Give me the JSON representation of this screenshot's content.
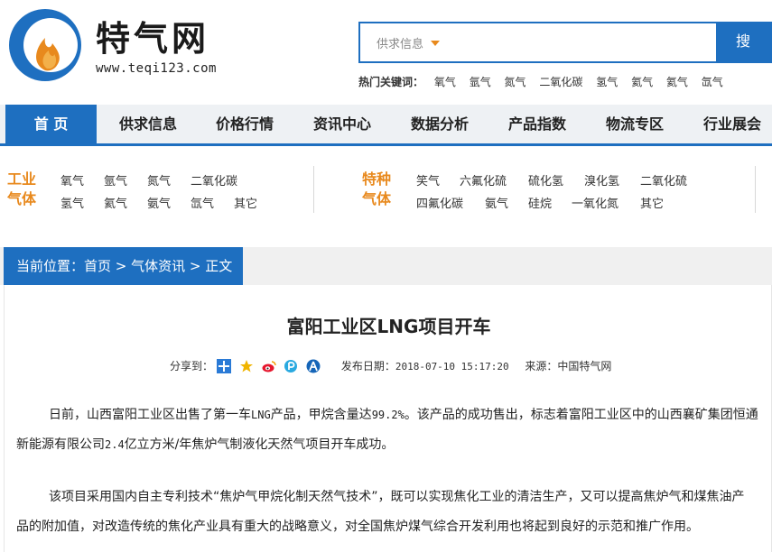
{
  "header": {
    "brand": "特气网",
    "url": "www.teqi123.com",
    "search_category": "供求信息",
    "search_button": "搜 索",
    "hot_label": "热门关键词：",
    "hot_keywords": [
      "氧气",
      "氩气",
      "氮气",
      "二氧化碳",
      "氢气",
      "氦气",
      "氦气",
      "氙气"
    ]
  },
  "nav": {
    "items": [
      "首 页",
      "供求信息",
      "价格行情",
      "资讯中心",
      "数据分析",
      "产品指数",
      "物流专区",
      "行业展会"
    ]
  },
  "categories": {
    "industrial": {
      "label_1": "工业",
      "label_2": "气体",
      "row1": [
        "氧气",
        "氩气",
        "氮气",
        "二氧化碳"
      ],
      "row2": [
        "氢气",
        "氦气",
        "氨气",
        "氙气",
        "其它"
      ]
    },
    "special": {
      "label_1": "特种",
      "label_2": "气体",
      "row1": [
        "笑气",
        "六氟化硫",
        "硫化氢",
        "溴化氢",
        "二氧化硫"
      ],
      "row2": [
        "四氟化碳",
        "氨气",
        "硅烷",
        "一氧化氮",
        "其它"
      ]
    }
  },
  "breadcrumb": {
    "prefix": "当前位置：",
    "items": [
      "首页",
      "气体资讯",
      "正文"
    ],
    "sep": " > "
  },
  "article": {
    "title": "富阳工业区LNG项目开车",
    "share_label": "分享到：",
    "date_label": "发布日期：",
    "date": "2018-07-10 15:17:20",
    "source_label": "来源：",
    "source": "中国特气网",
    "para1_a": "日前，山西富阳工业区出售了第一车",
    "para1_b": "LNG",
    "para1_c": "产品，甲烷含量达",
    "para1_d": "99.2%",
    "para1_e": "。该产品的成功售出，标志着富阳工业区中的山西襄矿集团恒通",
    "para1_f": "新能源有限公司",
    "para1_g": "2.4",
    "para1_h": "亿立方米/年焦炉气制液化天然气项目开车成功。",
    "para2_line1": "该项目采用国内自主专利技术“焦炉气甲烷化制天然气技术”，既可以实现焦化工业的清洁生产，又可以提高焦炉气和煤焦油产",
    "para2_line2": "品的附加值，对改造传统的焦化产业具有重大的战略意义，对全国焦炉煤气综合开发利用也将起到良好的示范和推广作用。"
  },
  "colors": {
    "brand_blue": "#1e6fc0",
    "accent_orange": "#e8891d"
  }
}
